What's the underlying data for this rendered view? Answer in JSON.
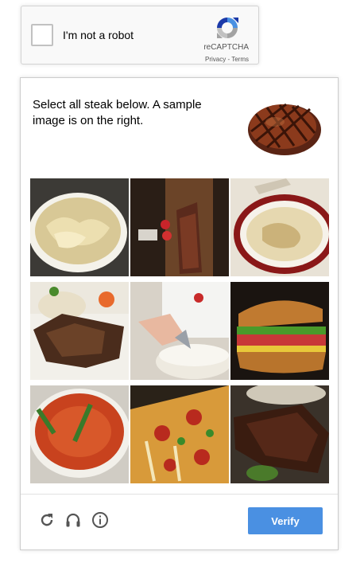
{
  "anchor": {
    "checkbox_label": "I'm not a robot",
    "brand": "reCAPTCHA",
    "privacy": "Privacy",
    "separator": " - ",
    "terms": "Terms"
  },
  "challenge": {
    "instruction": "Select all steak below. A sample image is on the right.",
    "sample_image": "steak",
    "tiles": [
      "dumpling-soup",
      "steak-on-board",
      "ramen-soup",
      "grilled-meat-rice",
      "cake-decorating",
      "sandwich",
      "red-soup",
      "pizza",
      "steak-on-plate"
    ],
    "verify_label": "Verify",
    "controls": [
      "reload-icon",
      "audio-icon",
      "info-icon"
    ]
  },
  "colors": {
    "verify_button": "#4a90e2",
    "recaptcha_blue": "#4a90e2",
    "recaptcha_gray": "#a3a3a3"
  }
}
